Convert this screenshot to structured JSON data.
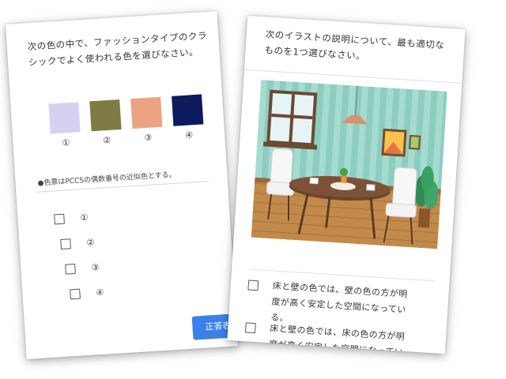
{
  "left_card": {
    "question_line1": "次の色の中で、ファッションタイプのクラ",
    "question_line2": "シックでよく使われる色を選びなさい。",
    "swatches": [
      {
        "color": "#d7d0f0",
        "label": "①"
      },
      {
        "color": "#7f7b45",
        "label": "②"
      },
      {
        "color": "#eca384",
        "label": "③"
      },
      {
        "color": "#0d1a5c",
        "label": "④"
      }
    ],
    "note": "●色票はPCCSの偶数番号の近似色とする。",
    "options": [
      "①",
      "②",
      "③",
      "④"
    ],
    "answer_button": "正答表示"
  },
  "right_card": {
    "question_line1": "次のイラストの説明について、最も適切な",
    "question_line2": "ものを1つ選びなさい。",
    "options": [
      {
        "line1": "床と壁の色では、壁の色の方が明",
        "line2": "度が高く安定した空間になってい",
        "line3": "る。"
      },
      {
        "line1": "床と壁の色では、床の色の方が明",
        "line2": "度が高く安定した空間になってい",
        "line3": ""
      }
    ]
  },
  "colors": {
    "accent_button": "#3b82e8",
    "wall_stripe_light": "#a6dccf",
    "wall_stripe_dark": "#8ccdbf",
    "floor": "#c28a4a"
  }
}
